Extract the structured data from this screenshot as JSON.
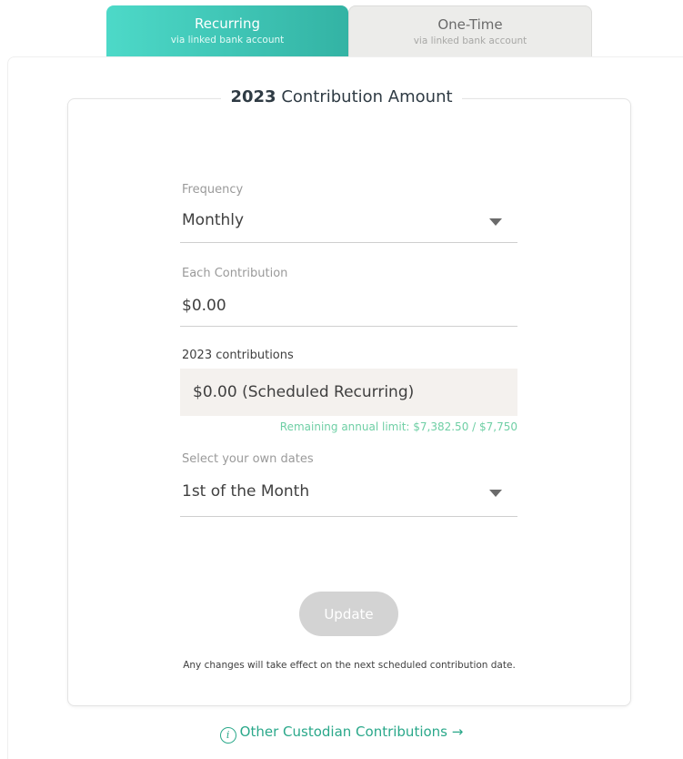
{
  "tabs": [
    {
      "title": "Recurring",
      "subtitle": "via linked bank account",
      "active": true
    },
    {
      "title": "One-Time",
      "subtitle": "via linked bank account",
      "active": false
    }
  ],
  "card": {
    "year": "2023",
    "title": "Contribution Amount"
  },
  "frequency": {
    "label": "Frequency",
    "value": "Monthly"
  },
  "each_contribution": {
    "label": "Each Contribution",
    "value": "$0.00"
  },
  "contributions": {
    "label": "2023 contributions",
    "summary": "$0.00 (Scheduled Recurring)",
    "remaining": "Remaining annual limit: $7,382.50 / $7,750"
  },
  "dates": {
    "label": "Select your own dates",
    "value": "1st of the Month"
  },
  "update_label": "Update",
  "note": "Any changes will take effect on the next scheduled contribution date.",
  "other_link": {
    "icon_text": "i",
    "label": "Other Custodian Contributions →"
  },
  "colors": {
    "accent": "#3cc5b5",
    "link": "#2aa88a",
    "remaining": "#6fcfa5",
    "button_disabled": "#d3d3d3"
  }
}
